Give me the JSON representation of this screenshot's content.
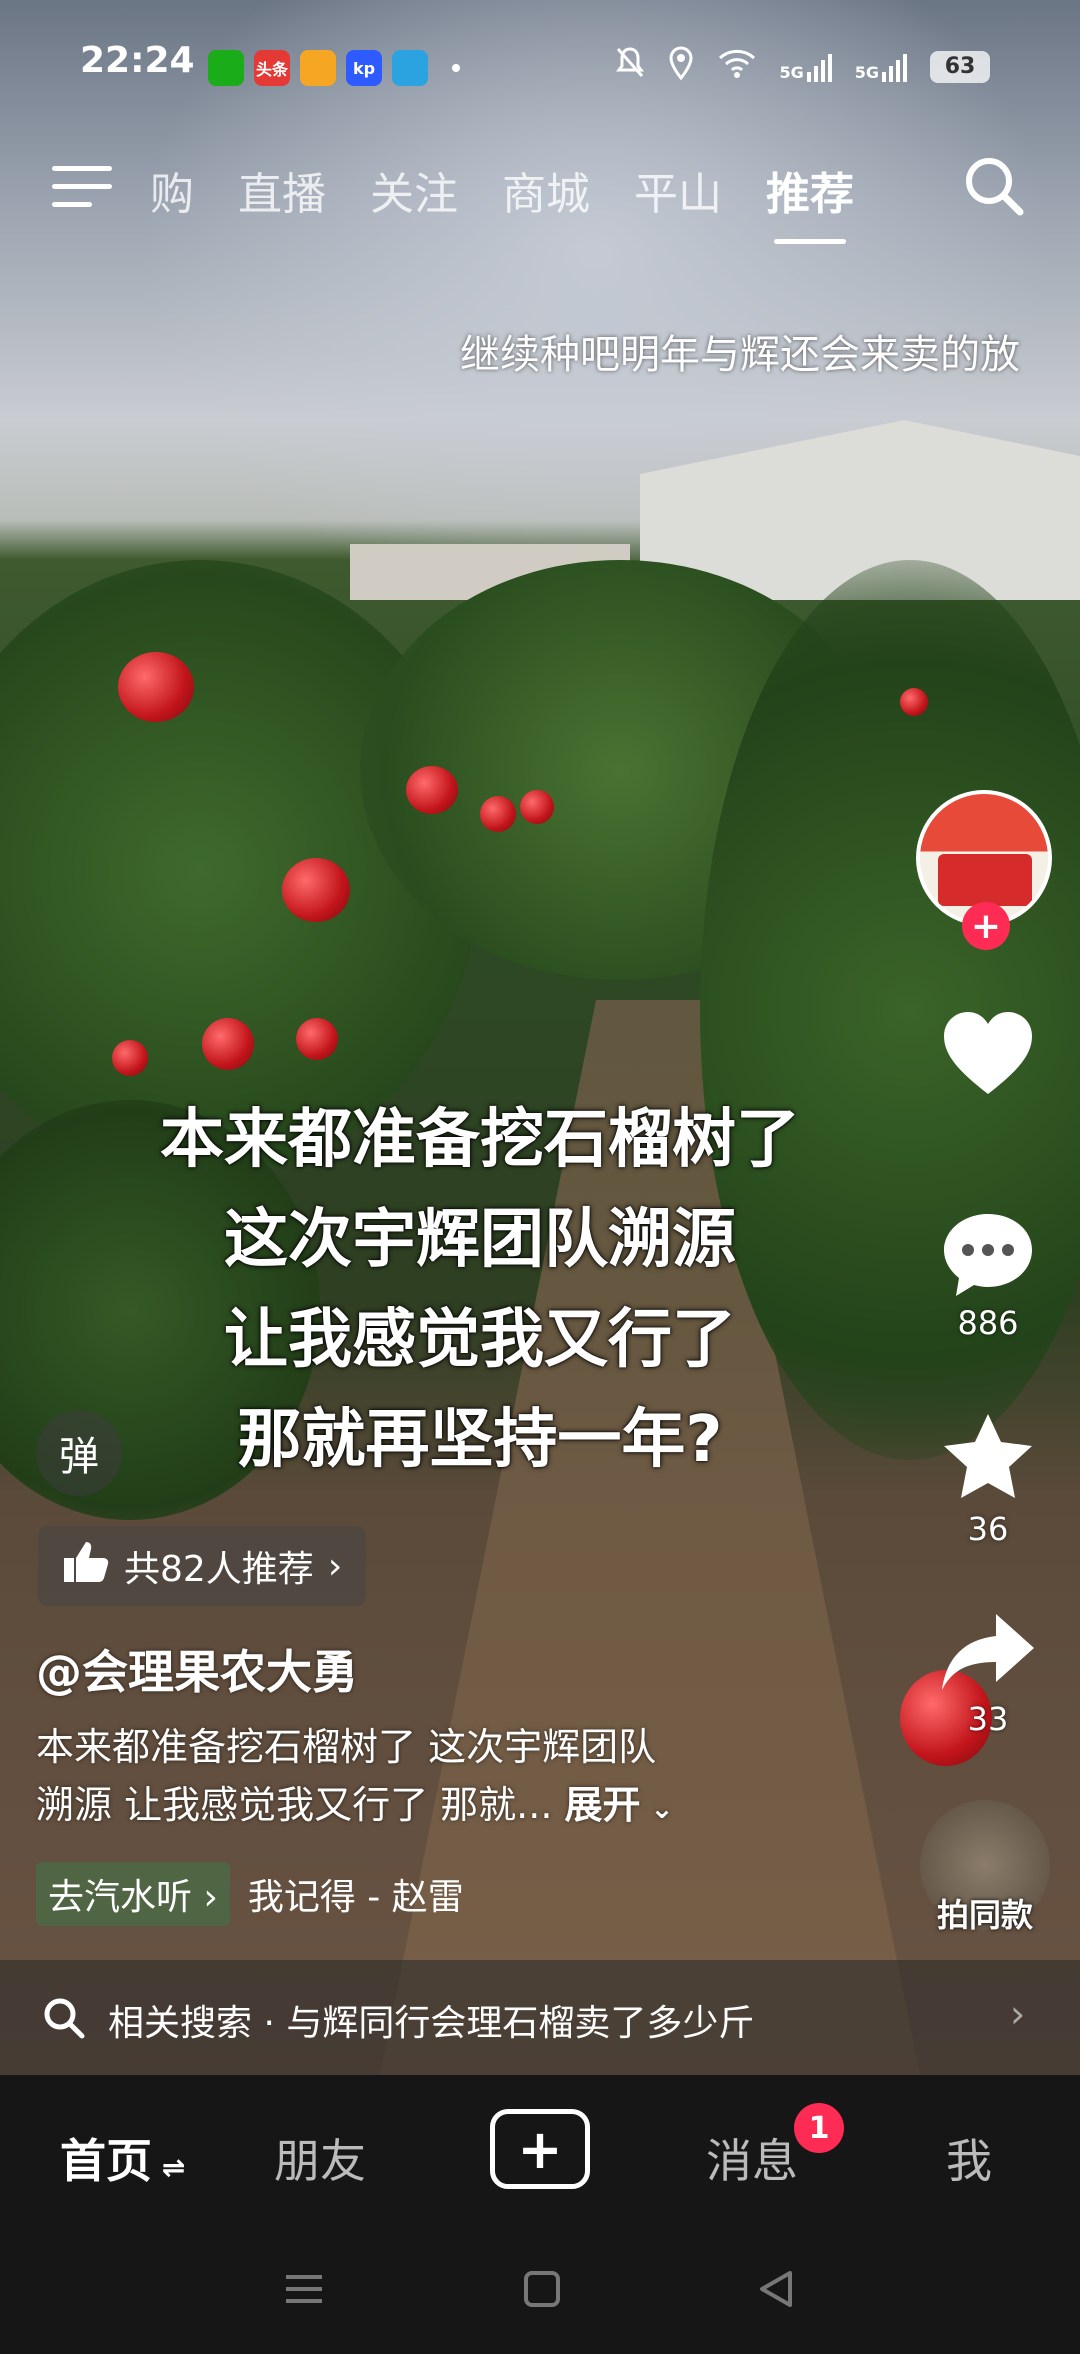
{
  "status": {
    "time": "22:24",
    "apps": [
      {
        "icon": "wechat-icon",
        "text": "",
        "color": "#1aad19"
      },
      {
        "icon": "toutiao-icon",
        "text": "头条",
        "color": "#e53935"
      },
      {
        "icon": "weather-icon",
        "text": "",
        "color": "#f5a623"
      },
      {
        "icon": "kp-app-icon",
        "text": "kp",
        "color": "#2d5bff"
      },
      {
        "icon": "telegram-icon",
        "text": "",
        "color": "#2aa3e0"
      }
    ],
    "network_a": "5G",
    "network_b": "5G",
    "battery": "63"
  },
  "topnav": {
    "tabs": [
      {
        "label": "购",
        "active": false
      },
      {
        "label": "直播",
        "active": false
      },
      {
        "label": "关注",
        "active": false
      },
      {
        "label": "商城",
        "active": false
      },
      {
        "label": "平山",
        "active": false
      },
      {
        "label": "推荐",
        "active": true
      }
    ]
  },
  "video": {
    "top_subtitle": "继续种吧明年与辉还会来卖的放",
    "caption_lines": [
      "本来都准备挖石榴树了",
      "这次宇辉团队溯源",
      "让我感觉我又行了",
      "那就再坚持一年?"
    ]
  },
  "actions": {
    "comments": "886",
    "favorites": "36",
    "shares": "33",
    "plus": "+"
  },
  "danmu_label": "弹",
  "recommend": {
    "label": "共82人推荐"
  },
  "author": "@会理果农大勇",
  "description": {
    "line1": "本来都准备挖石榴树了 这次宇辉团队",
    "line2": "溯源 让我感觉我又行了 那就...",
    "expand": "展开"
  },
  "music": {
    "tag": "去汽水听",
    "track": "我记得 - 赵雷"
  },
  "shoot_same": "拍同款",
  "related_search": "相关搜索 · 与辉同行会理石榴卖了多少斤",
  "bottomnav": {
    "home": "首页",
    "friends": "朋友",
    "create": "+",
    "messages": "消息",
    "messages_badge": "1",
    "me": "我"
  }
}
